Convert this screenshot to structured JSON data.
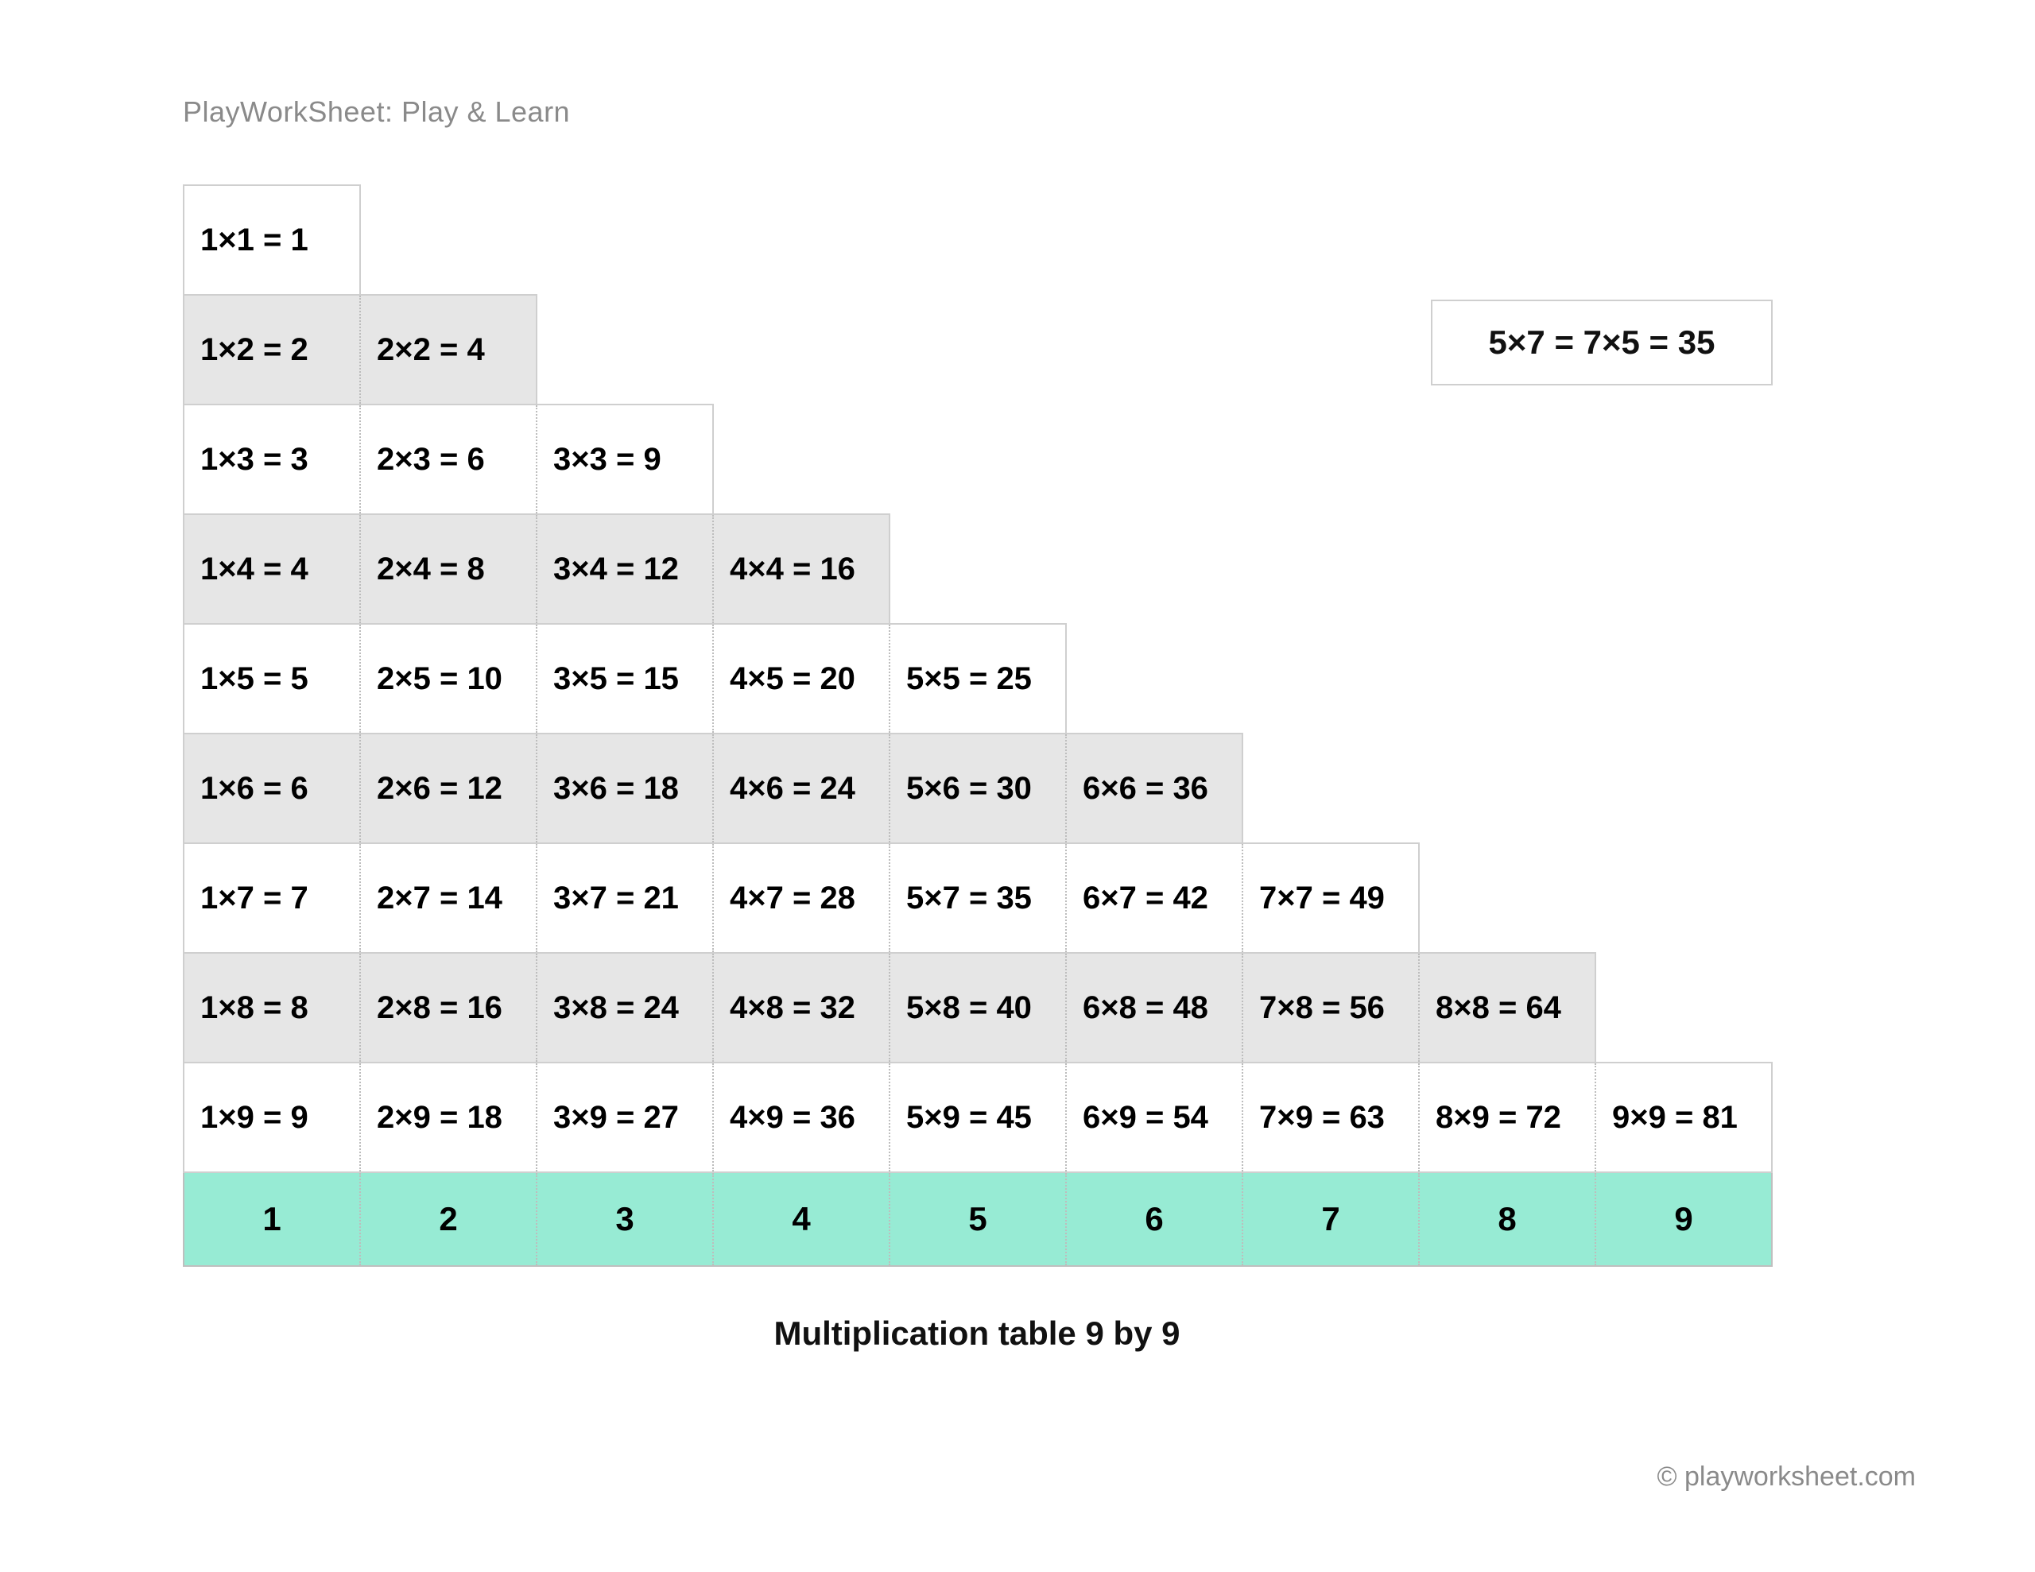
{
  "header": "PlayWorkSheet: Play & Learn",
  "caption": "Multiplication table 9 by 9",
  "footer": "© playworksheet.com",
  "example": "5×7 = 7×5 = 35",
  "footerCols": [
    "1",
    "2",
    "3",
    "4",
    "5",
    "6",
    "7",
    "8",
    "9"
  ],
  "rows": [
    {
      "alt": false,
      "cells": [
        "1×1 = 1"
      ]
    },
    {
      "alt": true,
      "cells": [
        "1×2 = 2",
        "2×2 = 4"
      ]
    },
    {
      "alt": false,
      "cells": [
        "1×3 = 3",
        "2×3 = 6",
        "3×3 = 9"
      ]
    },
    {
      "alt": true,
      "cells": [
        "1×4 = 4",
        "2×4 = 8",
        "3×4 = 12",
        "4×4 = 16"
      ]
    },
    {
      "alt": false,
      "cells": [
        "1×5 = 5",
        "2×5 = 10",
        "3×5 = 15",
        "4×5 = 20",
        "5×5 = 25"
      ]
    },
    {
      "alt": true,
      "cells": [
        "1×6 = 6",
        "2×6 = 12",
        "3×6 = 18",
        "4×6 = 24",
        "5×6 = 30",
        "6×6 = 36"
      ]
    },
    {
      "alt": false,
      "cells": [
        "1×7 = 7",
        "2×7 = 14",
        "3×7 = 21",
        "4×7 = 28",
        "5×7 = 35",
        "6×7 = 42",
        "7×7 = 49"
      ]
    },
    {
      "alt": true,
      "cells": [
        "1×8 = 8",
        "2×8 = 16",
        "3×8 = 24",
        "4×8 = 32",
        "5×8 = 40",
        "6×8 = 48",
        "7×8 = 56",
        "8×8 = 64"
      ]
    },
    {
      "alt": false,
      "cells": [
        "1×9 = 9",
        "2×9 = 18",
        "3×9 = 27",
        "4×9 = 36",
        "5×9 = 45",
        "6×9 = 54",
        "7×9 = 63",
        "8×9 = 72",
        "9×9 = 81"
      ]
    }
  ]
}
